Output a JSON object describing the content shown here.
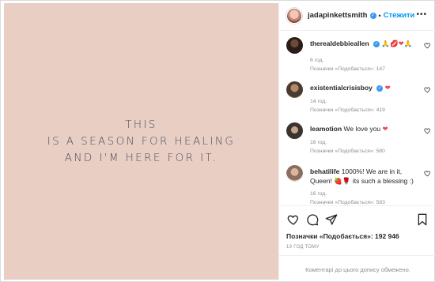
{
  "post": {
    "quote_lines": [
      "THIS",
      "IS A SEASON FOR HEALING",
      "AND I'M HERE FOR IT."
    ]
  },
  "header": {
    "username": "jadapinkettsmith",
    "separator": "•",
    "follow_label": "Стежити",
    "more_label": "•••"
  },
  "comments": [
    {
      "username": "therealdebbieallen",
      "text": "",
      "emojis": [
        "pray",
        "heart-lips",
        "heart",
        "pray"
      ],
      "age": "6 год.",
      "likes": "Позначки «Подобається»: 147"
    },
    {
      "username": "existentialcrisisboy",
      "text": "",
      "emojis": [
        "heart"
      ],
      "age": "14 год.",
      "likes": "Позначки «Подобається»: 419"
    },
    {
      "username": "leamotion",
      "text": "We love you",
      "emojis": [
        "heart"
      ],
      "age": "16 год.",
      "likes": "Позначки «Подобається»: 580"
    },
    {
      "username": "behatilife",
      "text_before": "1000%! We are in it, Queen!",
      "text_after": "its such a blessing :)",
      "emojis": [
        "strawberry",
        "rose"
      ],
      "age": "16 год.",
      "likes": "Позначки «Подобається»: 583"
    }
  ],
  "actions": {
    "likes": "Позначки «Подобається»: 192 946",
    "time": "19 ГОД ТОМУ",
    "comments_disabled": "Коментарі до цього допису обмежено."
  },
  "colors": {
    "post_background": "#e9cec4",
    "quote_text": "#4b4f60",
    "accent": "#0095f6",
    "heart_red": "#ed4956"
  }
}
